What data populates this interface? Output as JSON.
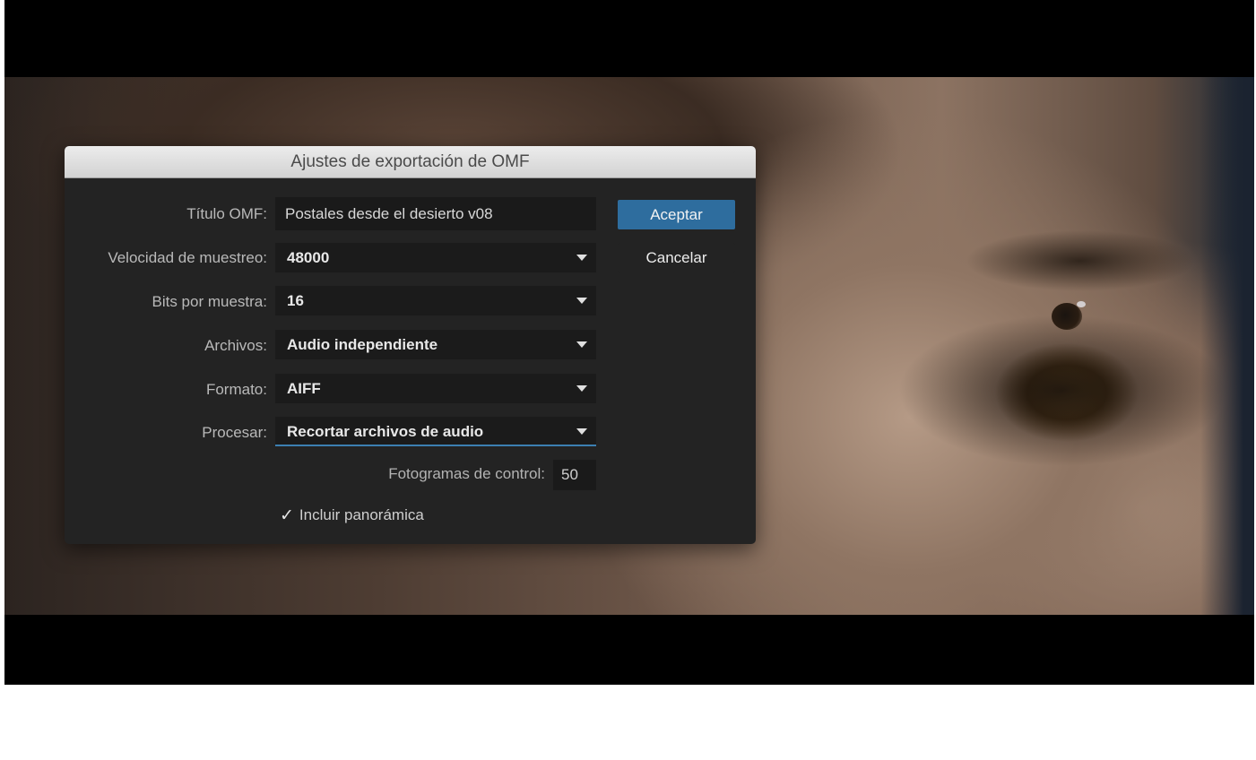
{
  "dialog": {
    "title": "Ajustes de exportación de OMF",
    "fields": {
      "omf_title": {
        "label": "Título OMF:",
        "value": "Postales desde el desierto v08"
      },
      "sample_rate": {
        "label": "Velocidad de muestreo:",
        "value": "48000"
      },
      "bits_per_sample": {
        "label": "Bits por muestra:",
        "value": "16"
      },
      "files": {
        "label": "Archivos:",
        "value": "Audio independiente"
      },
      "format": {
        "label": "Formato:",
        "value": "AIFF"
      },
      "process": {
        "label": "Procesar:",
        "value": "Recortar archivos de audio"
      },
      "handle_frames": {
        "label": "Fotogramas de control:",
        "value": "50"
      }
    },
    "include_pan": {
      "label": "Incluir panorámica",
      "checked": true,
      "mark": "✓"
    },
    "buttons": {
      "ok": "Aceptar",
      "cancel": "Cancelar"
    }
  },
  "colors": {
    "dialog_bg": "#232323",
    "titlebar": "#dedede",
    "accent": "#2e6d9e",
    "focus_line": "#3c7fb1"
  },
  "icons": {
    "dropdown": "chevron-down-icon",
    "checkbox": "checkmark-icon"
  }
}
